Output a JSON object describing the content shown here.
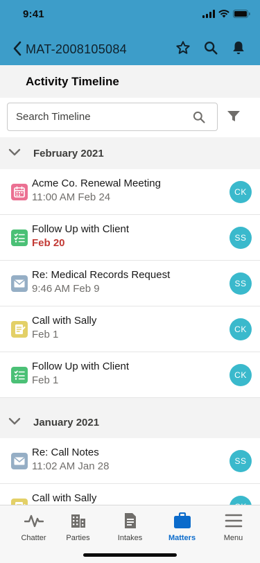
{
  "status_bar": {
    "time": "9:41"
  },
  "nav": {
    "record_title": "MAT-2008105084"
  },
  "page": {
    "title": "Activity Timeline"
  },
  "search": {
    "placeholder": "Search Timeline"
  },
  "sections": [
    {
      "label": "February 2021",
      "items": [
        {
          "icon": "calendar-event-icon",
          "icon_color": "#eb7092",
          "subject": "Acme Co. Renewal Meeting",
          "when": "11:00 AM Feb 24",
          "overdue": false,
          "owner": "CK"
        },
        {
          "icon": "task-icon",
          "icon_color": "#4bc076",
          "subject": "Follow Up with Client",
          "when": "Feb 20",
          "overdue": true,
          "owner": "SS"
        },
        {
          "icon": "email-icon",
          "icon_color": "#95aec5",
          "subject": "Re: Medical Records Request",
          "when": "9:46 AM Feb 9",
          "overdue": false,
          "owner": "SS"
        },
        {
          "icon": "call-log-icon",
          "icon_color": "#e3d067",
          "subject": "Call with Sally",
          "when": "Feb 1",
          "overdue": false,
          "owner": "CK"
        },
        {
          "icon": "task-icon",
          "icon_color": "#4bc076",
          "subject": "Follow Up with Client",
          "when": "Feb 1",
          "overdue": false,
          "owner": "CK"
        }
      ]
    },
    {
      "label": "January 2021",
      "items": [
        {
          "icon": "email-icon",
          "icon_color": "#95aec5",
          "subject": "Re: Call Notes",
          "when": "11:02 AM Jan 28",
          "overdue": false,
          "owner": "SS"
        },
        {
          "icon": "call-log-icon",
          "icon_color": "#e3d067",
          "subject": "Call with Sally",
          "when": "",
          "overdue": false,
          "owner": "CK"
        }
      ]
    }
  ],
  "tabs": [
    {
      "label": "Chatter",
      "icon": "pulse-icon",
      "active": false
    },
    {
      "label": "Parties",
      "icon": "building-icon",
      "active": false
    },
    {
      "label": "Intakes",
      "icon": "document-icon",
      "active": false
    },
    {
      "label": "Matters",
      "icon": "briefcase-icon",
      "active": true
    },
    {
      "label": "Menu",
      "icon": "hamburger-icon",
      "active": false
    }
  ],
  "colors": {
    "header": "#3d9dc9",
    "avatar": "#3ab9cc",
    "overdue": "#c23934",
    "active_tab": "#0b6bcb"
  }
}
